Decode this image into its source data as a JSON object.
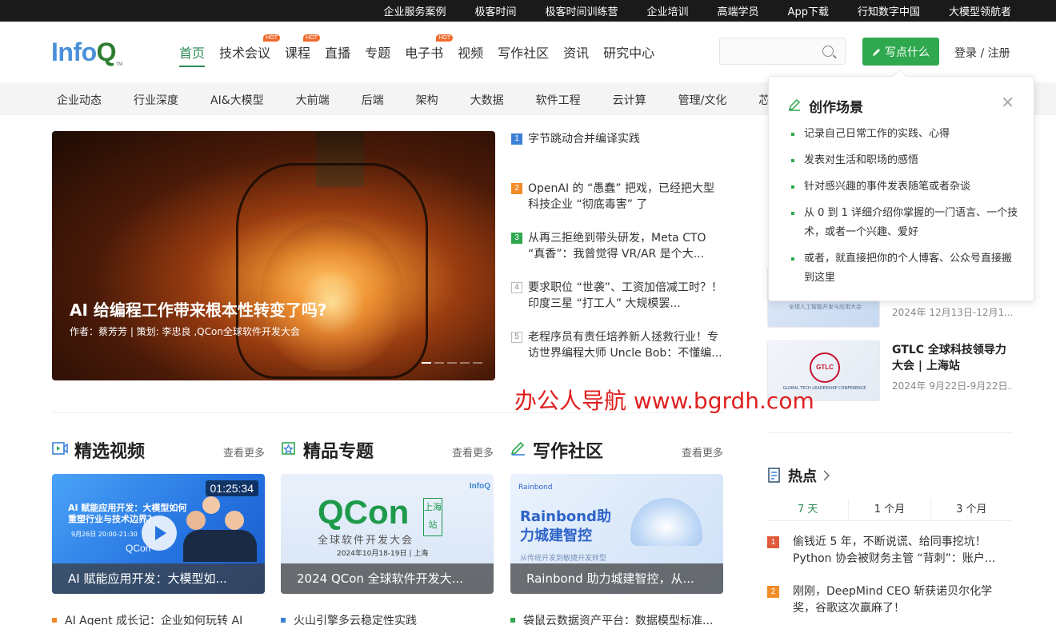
{
  "topbar": [
    "企业服务案例",
    "极客时间",
    "极客时间训练营",
    "企业培训",
    "高端学员",
    "App下载",
    "行知数字中国",
    "大模型领航者"
  ],
  "brand": {
    "logo_main": "Info",
    "logo_q": "Q",
    "logo_tm": "TM"
  },
  "nav": [
    {
      "label": "首页",
      "active": true,
      "hot": false
    },
    {
      "label": "技术会议",
      "active": false,
      "hot": true
    },
    {
      "label": "课程",
      "active": false,
      "hot": true
    },
    {
      "label": "直播",
      "active": false,
      "hot": false
    },
    {
      "label": "专题",
      "active": false,
      "hot": false
    },
    {
      "label": "电子书",
      "active": false,
      "hot": true
    },
    {
      "label": "视频",
      "active": false,
      "hot": false
    },
    {
      "label": "写作社区",
      "active": false,
      "hot": false
    },
    {
      "label": "资讯",
      "active": false,
      "hot": false
    },
    {
      "label": "研究中心",
      "active": false,
      "hot": false
    }
  ],
  "hot_badge": "HOT",
  "search": {
    "placeholder": ""
  },
  "write_button": "写点什么",
  "login": "登录 / 注册",
  "categories": [
    "企业动态",
    "行业深度",
    "AI&大模型",
    "大前端",
    "后端",
    "架构",
    "大数据",
    "软件工程",
    "云计算",
    "管理/文化",
    "芯片&算"
  ],
  "hero": {
    "title": "AI 给编程工作带来根本性转变了吗?",
    "meta": "作者：蔡芳芳 | 策划: 李忠良 ,QCon全球软件开发大会",
    "slides": 5,
    "active_slide": 1
  },
  "headlines": [
    {
      "num": "1",
      "text": "字节跳动合并编译实践"
    },
    {
      "num": "2",
      "text": "OpenAI 的 “愚蠢” 把戏，已经把大型科技企业 “彻底毒害” 了"
    },
    {
      "num": "3",
      "text": "从再三拒绝到带头研发，Meta CTO “真香”：我曾觉得 VR/AR 是个大..."
    },
    {
      "num": "4",
      "text": "要求职位 “世袭”、工资加倍减工时？！印度三星 “打工人” 大规模罢..."
    },
    {
      "num": "5",
      "text": "老程序员有责任培养新人拯救行业！专访世界编程大师 Uncle Bob：不懂编..."
    }
  ],
  "sections": [
    {
      "title": "精选视频",
      "more": "查看更多",
      "card_caption": "AI 赋能应用开发：大模型如...",
      "list_first": "AI Agent 成长记：企业如何玩转 AI"
    },
    {
      "title": "精品专题",
      "more": "查看更多",
      "card_caption": "2024 QCon 全球软件开发大...",
      "list_first": "火山引擎多云稳定性实践"
    },
    {
      "title": "写作社区",
      "more": "查看更多",
      "card_caption": "Rainbond 助力城建智控，从...",
      "list_first": "袋鼠云数据资产平台：数据模型标准..."
    }
  ],
  "video_card": {
    "duration": "01:25:34",
    "poster_text": "AI 赋能应用开发：大模型如何重塑行业与技术边界？",
    "poster_date": "9月26日 20:00-21:30",
    "poster_brand": "QCon"
  },
  "qcon_card": {
    "logo": "QCon",
    "tag": "上海站",
    "subtitle": "全球软件开发大会",
    "date": "2024年10月18-19日 | 上海",
    "brand": "InfoQ"
  },
  "rainbond_card": {
    "logo": "Rainbond",
    "title": "Rainbond助力城建智控",
    "subtitle": "从传统开发到敏捷开发转型"
  },
  "events": [
    {
      "title": "",
      "date": "2024年 12月13日-12月1...",
      "thumb_text": "全球人工智能开发与应用大会"
    },
    {
      "title": "GTLC 全球科技领导力大会 | 上海站",
      "date": "2024年 9月22日-9月22日...",
      "thumb_text": "GTLC",
      "thumb_sub": "GLOBAL TECH LEADERSHIP CONFERENCE"
    }
  ],
  "hot_section": {
    "title": "热点",
    "tabs": [
      "7 天",
      "1 个月",
      "3 个月"
    ],
    "active_tab": 0,
    "items": [
      {
        "num": "1",
        "text": "偷钱近 5 年，不断说谎、给同事挖坑！Python 协会被财务主管 “背刺”：账户..."
      },
      {
        "num": "2",
        "text": "刚刚，DeepMind CEO 斩获诺贝尔化学奖，谷歌这次赢麻了！"
      }
    ]
  },
  "popup": {
    "title": "创作场景",
    "items": [
      "记录自己日常工作的实践、心得",
      "发表对生活和职场的感悟",
      "针对感兴趣的事件发表随笔或者杂谈",
      "从 0 到 1 详细介绍你掌握的一门语言、一个技术，或者一个兴趣、爱好",
      "或者，就直接把你的个人博客、公众号直接搬到这里"
    ]
  },
  "watermark": "办公人导航 www.bgrdh.com",
  "colors": {
    "brand_green": "#2fa84f",
    "nav_active": "#2e8b57",
    "hot_orange": "#f06a2a",
    "rank1": "#e05a3a",
    "rank2": "#f28c28",
    "rank3": "#2fa84f",
    "headline1": "#3b82d6"
  }
}
